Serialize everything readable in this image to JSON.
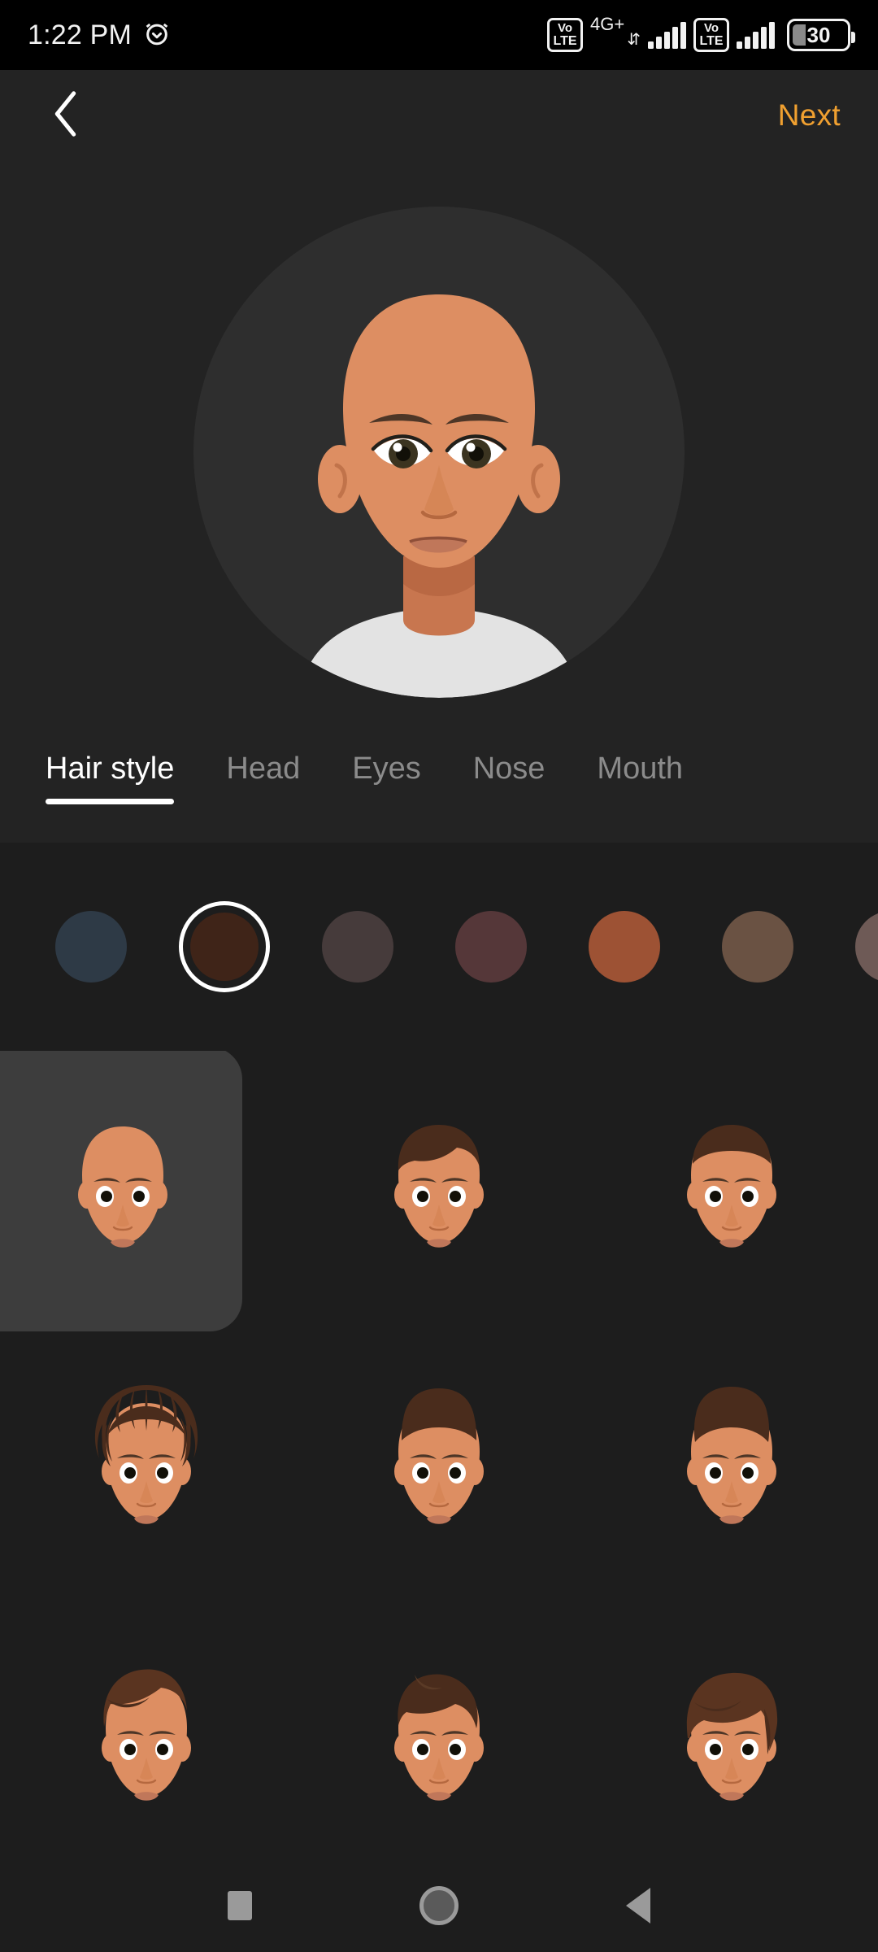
{
  "status_bar": {
    "time": "1:22 PM",
    "alarm_icon": "alarm-clock-icon",
    "sim1_volte": {
      "top": "Vo",
      "bottom": "LTE"
    },
    "network_label": "4G+",
    "sim2_volte": {
      "top": "Vo",
      "bottom": "LTE"
    },
    "battery_level": "30"
  },
  "header": {
    "back_icon": "chevron-left-icon",
    "next_label": "Next",
    "next_color": "#f0a030"
  },
  "preview": {
    "shuffle_icon": "shuffle-icon",
    "circle_bg": "#2e2e2e",
    "skin_color": "#dd8e62",
    "shirt_color": "#e3e3e3",
    "hair_style": "bald"
  },
  "tabs": [
    {
      "label": "Hair style",
      "active": true
    },
    {
      "label": "Head",
      "active": false
    },
    {
      "label": "Eyes",
      "active": false
    },
    {
      "label": "Nose",
      "active": false
    },
    {
      "label": "Mouth",
      "active": false
    }
  ],
  "hair_colors": [
    {
      "name": "blue-black",
      "hex": "#2e3a46",
      "selected": false
    },
    {
      "name": "dark-brown",
      "hex": "#3f2418",
      "selected": true
    },
    {
      "name": "ash-brown",
      "hex": "#463b3b",
      "selected": false
    },
    {
      "name": "dark-auburn",
      "hex": "#553739",
      "selected": false
    },
    {
      "name": "rust-copper",
      "hex": "#9d5234",
      "selected": false
    },
    {
      "name": "medium-brown",
      "hex": "#6a5243",
      "selected": false
    },
    {
      "name": "mauve-grey",
      "hex": "#6e5a56",
      "selected": false
    }
  ],
  "hair_grid": {
    "rows": [
      [
        {
          "name": "bald",
          "selected": true
        },
        {
          "name": "short-wavy",
          "selected": false
        },
        {
          "name": "short-crop-fade",
          "selected": false
        }
      ],
      [
        {
          "name": "dreadlocks",
          "selected": false
        },
        {
          "name": "high-top-fade",
          "selected": false
        },
        {
          "name": "flat-top-fade",
          "selected": false
        }
      ],
      [
        {
          "name": "side-swept-quiff",
          "selected": false
        },
        {
          "name": "textured-pompadour",
          "selected": false
        },
        {
          "name": "shaggy-layered",
          "selected": false
        }
      ]
    ]
  },
  "nav_bar": {
    "recents": "recents-square-icon",
    "home": "home-circle-icon",
    "back": "back-triangle-icon"
  }
}
